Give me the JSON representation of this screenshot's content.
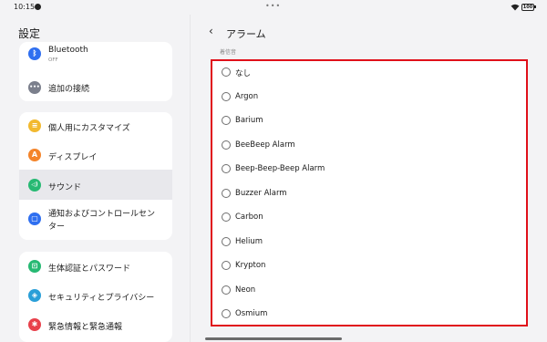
{
  "status_bar": {
    "time": "10:15",
    "more": "•••",
    "battery": "100"
  },
  "settings": {
    "title": "設定"
  },
  "groups": [
    {
      "items": [
        {
          "label": "Bluetooth",
          "sublabel": "OFF",
          "icon": "bluetooth-icon",
          "color": "#2f6ff0",
          "glyph": "ᛒ"
        },
        {
          "label": "追加の接続",
          "icon": "more-connections-icon",
          "color": "#7b7f8c",
          "glyph": "•••"
        }
      ]
    },
    {
      "items": [
        {
          "label": "個人用にカスタマイズ",
          "icon": "personalize-icon",
          "color": "#f2b92f",
          "glyph": "≡"
        },
        {
          "label": "ディスプレイ",
          "icon": "display-icon",
          "color": "#f4842a",
          "glyph": "A"
        },
        {
          "label": "サウンド",
          "icon": "sound-icon",
          "color": "#27b973",
          "glyph": "◁)"
        },
        {
          "label": "通知およびコントロールセン",
          "label2": "ター",
          "icon": "notification-icon",
          "color": "#2f6ff0",
          "glyph": "▢"
        }
      ]
    },
    {
      "items": [
        {
          "label": "生体認証とパスワード",
          "icon": "lock-icon",
          "color": "#27b973",
          "glyph": "⊡"
        },
        {
          "label": "セキュリティとプライバシー",
          "icon": "shield-icon",
          "color": "#2a9fd8",
          "glyph": "◈"
        },
        {
          "label": "緊急情報と緊急通報",
          "icon": "emergency-icon",
          "color": "#e8414b",
          "glyph": "✱"
        }
      ]
    }
  ],
  "detail": {
    "back_glyph": "‹",
    "title": "アラーム",
    "section_label": "着信音",
    "ringtones": [
      "なし",
      "Argon",
      "Barium",
      "BeeBeep Alarm",
      "Beep-Beep-Beep Alarm",
      "Buzzer Alarm",
      "Carbon",
      "Helium",
      "Krypton",
      "Neon",
      "Osmium"
    ]
  },
  "colors": {
    "highlight_border": "#e0101a",
    "selected_bg": "#e8e8ec"
  }
}
